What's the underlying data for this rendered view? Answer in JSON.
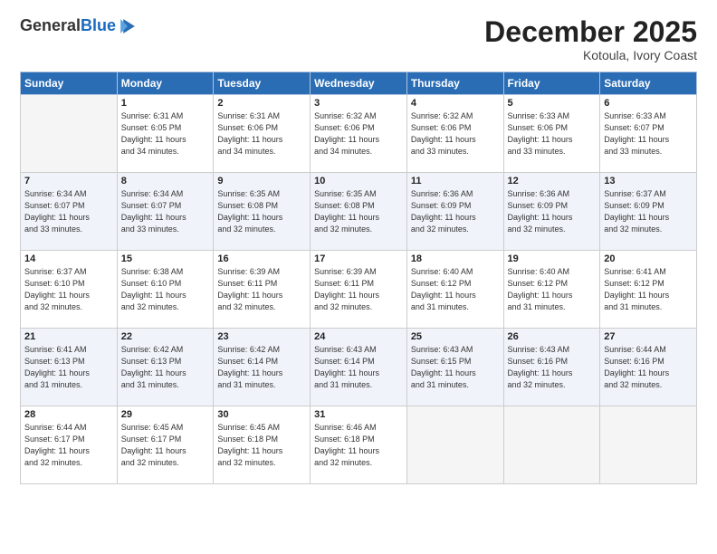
{
  "logo": {
    "general": "General",
    "blue": "Blue"
  },
  "header": {
    "month": "December 2025",
    "location": "Kotoula, Ivory Coast"
  },
  "weekdays": [
    "Sunday",
    "Monday",
    "Tuesday",
    "Wednesday",
    "Thursday",
    "Friday",
    "Saturday"
  ],
  "weeks": [
    [
      {
        "day": "",
        "info": ""
      },
      {
        "day": "1",
        "info": "Sunrise: 6:31 AM\nSunset: 6:05 PM\nDaylight: 11 hours\nand 34 minutes."
      },
      {
        "day": "2",
        "info": "Sunrise: 6:31 AM\nSunset: 6:06 PM\nDaylight: 11 hours\nand 34 minutes."
      },
      {
        "day": "3",
        "info": "Sunrise: 6:32 AM\nSunset: 6:06 PM\nDaylight: 11 hours\nand 34 minutes."
      },
      {
        "day": "4",
        "info": "Sunrise: 6:32 AM\nSunset: 6:06 PM\nDaylight: 11 hours\nand 33 minutes."
      },
      {
        "day": "5",
        "info": "Sunrise: 6:33 AM\nSunset: 6:06 PM\nDaylight: 11 hours\nand 33 minutes."
      },
      {
        "day": "6",
        "info": "Sunrise: 6:33 AM\nSunset: 6:07 PM\nDaylight: 11 hours\nand 33 minutes."
      }
    ],
    [
      {
        "day": "7",
        "info": "Sunrise: 6:34 AM\nSunset: 6:07 PM\nDaylight: 11 hours\nand 33 minutes."
      },
      {
        "day": "8",
        "info": "Sunrise: 6:34 AM\nSunset: 6:07 PM\nDaylight: 11 hours\nand 33 minutes."
      },
      {
        "day": "9",
        "info": "Sunrise: 6:35 AM\nSunset: 6:08 PM\nDaylight: 11 hours\nand 32 minutes."
      },
      {
        "day": "10",
        "info": "Sunrise: 6:35 AM\nSunset: 6:08 PM\nDaylight: 11 hours\nand 32 minutes."
      },
      {
        "day": "11",
        "info": "Sunrise: 6:36 AM\nSunset: 6:09 PM\nDaylight: 11 hours\nand 32 minutes."
      },
      {
        "day": "12",
        "info": "Sunrise: 6:36 AM\nSunset: 6:09 PM\nDaylight: 11 hours\nand 32 minutes."
      },
      {
        "day": "13",
        "info": "Sunrise: 6:37 AM\nSunset: 6:09 PM\nDaylight: 11 hours\nand 32 minutes."
      }
    ],
    [
      {
        "day": "14",
        "info": "Sunrise: 6:37 AM\nSunset: 6:10 PM\nDaylight: 11 hours\nand 32 minutes."
      },
      {
        "day": "15",
        "info": "Sunrise: 6:38 AM\nSunset: 6:10 PM\nDaylight: 11 hours\nand 32 minutes."
      },
      {
        "day": "16",
        "info": "Sunrise: 6:39 AM\nSunset: 6:11 PM\nDaylight: 11 hours\nand 32 minutes."
      },
      {
        "day": "17",
        "info": "Sunrise: 6:39 AM\nSunset: 6:11 PM\nDaylight: 11 hours\nand 32 minutes."
      },
      {
        "day": "18",
        "info": "Sunrise: 6:40 AM\nSunset: 6:12 PM\nDaylight: 11 hours\nand 31 minutes."
      },
      {
        "day": "19",
        "info": "Sunrise: 6:40 AM\nSunset: 6:12 PM\nDaylight: 11 hours\nand 31 minutes."
      },
      {
        "day": "20",
        "info": "Sunrise: 6:41 AM\nSunset: 6:12 PM\nDaylight: 11 hours\nand 31 minutes."
      }
    ],
    [
      {
        "day": "21",
        "info": "Sunrise: 6:41 AM\nSunset: 6:13 PM\nDaylight: 11 hours\nand 31 minutes."
      },
      {
        "day": "22",
        "info": "Sunrise: 6:42 AM\nSunset: 6:13 PM\nDaylight: 11 hours\nand 31 minutes."
      },
      {
        "day": "23",
        "info": "Sunrise: 6:42 AM\nSunset: 6:14 PM\nDaylight: 11 hours\nand 31 minutes."
      },
      {
        "day": "24",
        "info": "Sunrise: 6:43 AM\nSunset: 6:14 PM\nDaylight: 11 hours\nand 31 minutes."
      },
      {
        "day": "25",
        "info": "Sunrise: 6:43 AM\nSunset: 6:15 PM\nDaylight: 11 hours\nand 31 minutes."
      },
      {
        "day": "26",
        "info": "Sunrise: 6:43 AM\nSunset: 6:16 PM\nDaylight: 11 hours\nand 32 minutes."
      },
      {
        "day": "27",
        "info": "Sunrise: 6:44 AM\nSunset: 6:16 PM\nDaylight: 11 hours\nand 32 minutes."
      }
    ],
    [
      {
        "day": "28",
        "info": "Sunrise: 6:44 AM\nSunset: 6:17 PM\nDaylight: 11 hours\nand 32 minutes."
      },
      {
        "day": "29",
        "info": "Sunrise: 6:45 AM\nSunset: 6:17 PM\nDaylight: 11 hours\nand 32 minutes."
      },
      {
        "day": "30",
        "info": "Sunrise: 6:45 AM\nSunset: 6:18 PM\nDaylight: 11 hours\nand 32 minutes."
      },
      {
        "day": "31",
        "info": "Sunrise: 6:46 AM\nSunset: 6:18 PM\nDaylight: 11 hours\nand 32 minutes."
      },
      {
        "day": "",
        "info": ""
      },
      {
        "day": "",
        "info": ""
      },
      {
        "day": "",
        "info": ""
      }
    ]
  ]
}
